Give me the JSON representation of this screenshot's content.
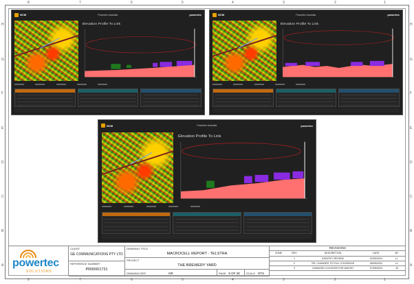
{
  "grid": {
    "top_columns": [
      "8",
      "7",
      "6",
      "5",
      "4",
      "3",
      "2",
      "1"
    ],
    "rows": [
      "H",
      "G",
      "F",
      "E",
      "D",
      "C",
      "B",
      "A"
    ]
  },
  "panels": [
    {
      "id": "top-left",
      "brand": "NCM",
      "title": "Powertec Australia",
      "right": "powertec",
      "plot_head": "Elevation Profile To Link"
    },
    {
      "id": "top-right",
      "brand": "NCM",
      "title": "Powertec Australia",
      "right": "powertec",
      "plot_head": "Elevation Profile To Link"
    },
    {
      "id": "bottom-center",
      "brand": "NCM",
      "title": "Powertec Australia",
      "right": "powertec",
      "plot_head": "Elevation Profile To Link"
    }
  ],
  "title_block": {
    "brand_name": "powertec",
    "brand_sub": "SOLUTIONS",
    "client_label": "CLIENT",
    "client": "GE COMMUNICATIONS PTY LTD",
    "ref_label": "REFERENCE NUMBER",
    "ref": "PR00001731",
    "drawing_title_label": "DRAWING TITLE",
    "drawing_title": "MACROCELL REPORT - TELSTRA",
    "project_label": "PROJECT",
    "project": "THE BREWERY YARD",
    "drawing_ref_label": "DRAWING REF",
    "drawing_ref": "NR",
    "page_label": "PAGE",
    "page": "8 OF 28",
    "scale_label": "SCALE",
    "scale": "NTS"
  },
  "revisions": {
    "heading": "REVISIONS",
    "columns": [
      "ZONE",
      "REV",
      "DESCRIPTION",
      "DATE",
      "BY"
    ],
    "rows": [
      {
        "zone": "",
        "rev": "1",
        "description": "IDENTIFY REVIEW",
        "date": "02/05/2024",
        "by": "LL"
      },
      {
        "zone": "",
        "rev": "2",
        "description": "TEL CHANGED TO FULL COVERAGE",
        "date": "06/05/2024",
        "by": "LL"
      },
      {
        "zone": "",
        "rev": "3",
        "description": "CHANGED LOCATION FOR MACRO",
        "date": "07/05/2024",
        "by": "JK"
      }
    ]
  }
}
